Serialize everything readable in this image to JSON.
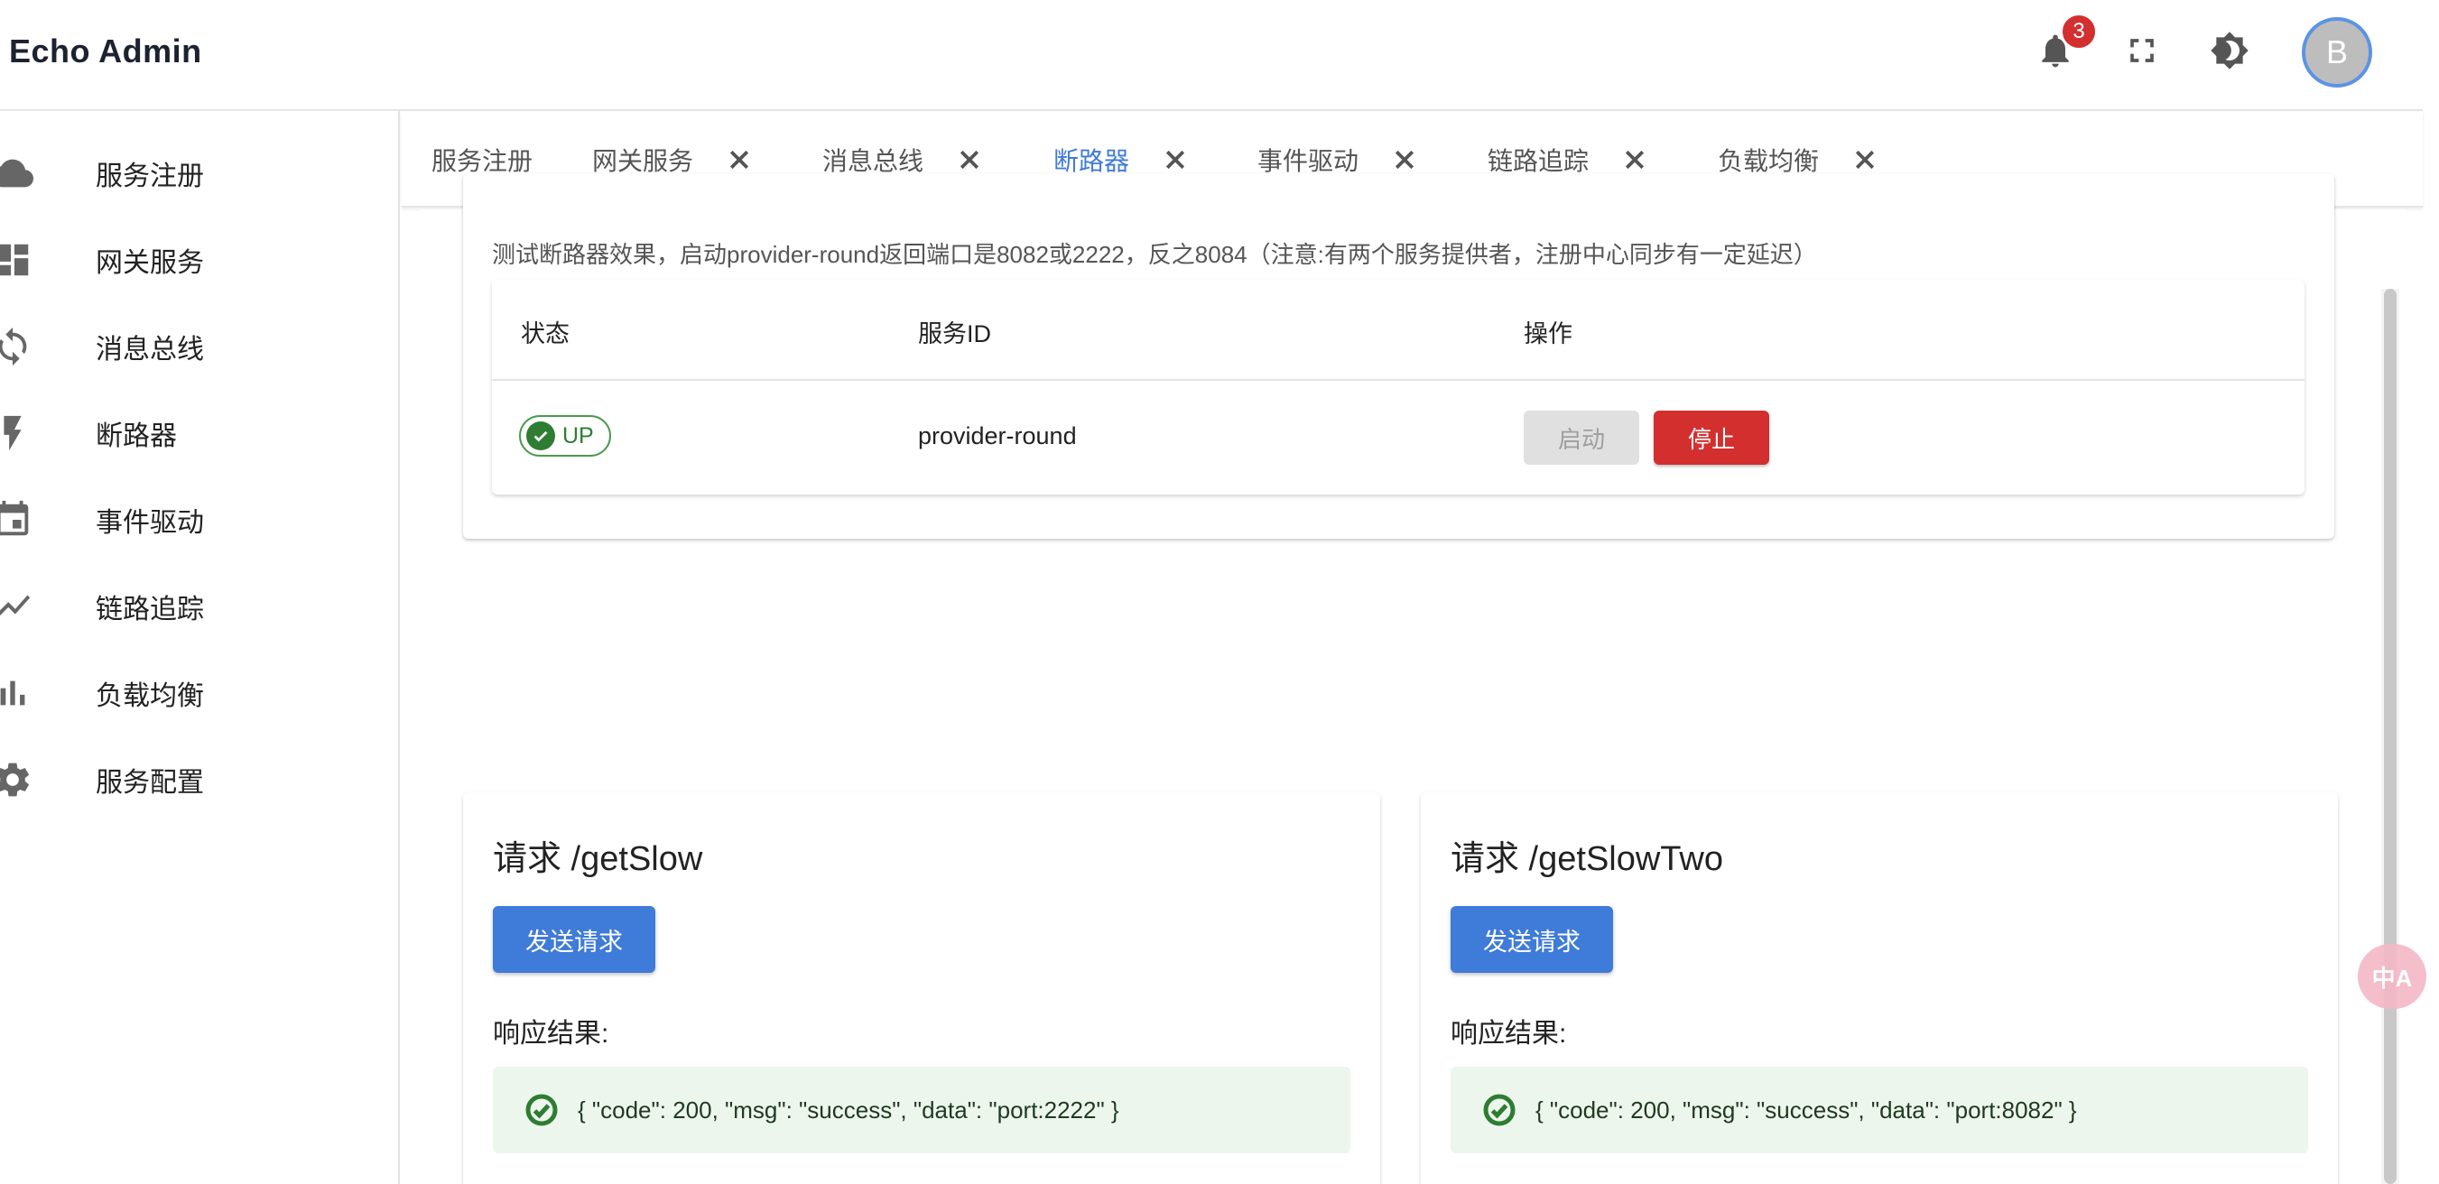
{
  "header": {
    "title": "Echo Admin",
    "notification_count": "3",
    "avatar_letter": "B"
  },
  "sidebar": {
    "items": [
      {
        "label": "服务注册",
        "icon": "cloud-icon"
      },
      {
        "label": "网关服务",
        "icon": "dashboard-icon"
      },
      {
        "label": "消息总线",
        "icon": "sync-icon"
      },
      {
        "label": "断路器",
        "icon": "bolt-icon"
      },
      {
        "label": "事件驱动",
        "icon": "calendar-icon"
      },
      {
        "label": "链路追踪",
        "icon": "trending-icon"
      },
      {
        "label": "负载均衡",
        "icon": "bar-chart-icon"
      },
      {
        "label": "服务配置",
        "icon": "gear-icon"
      }
    ]
  },
  "tabs": [
    {
      "label": "服务注册",
      "closable": false
    },
    {
      "label": "网关服务",
      "closable": true
    },
    {
      "label": "消息总线",
      "closable": true
    },
    {
      "label": "断路器",
      "closable": true,
      "active": true
    },
    {
      "label": "事件驱动",
      "closable": true
    },
    {
      "label": "链路追踪",
      "closable": true
    },
    {
      "label": "负载均衡",
      "closable": true
    }
  ],
  "main": {
    "description": "测试断路器效果，启动provider-round返回端口是8082或2222，反之8084（注意:有两个服务提供者，注册中心同步有一定延迟）",
    "table": {
      "headers": [
        "状态",
        "服务ID",
        "操作"
      ],
      "row": {
        "status": "UP",
        "service_id": "provider-round",
        "start_label": "启动",
        "stop_label": "停止"
      }
    },
    "requests": [
      {
        "title": "请求 /getSlow",
        "send_label": "发送请求",
        "result_label": "响应结果:",
        "result": "{ \"code\": 200, \"msg\": \"success\", \"data\": \"port:2222\" }"
      },
      {
        "title": "请求 /getSlowTwo",
        "send_label": "发送请求",
        "result_label": "响应结果:",
        "result": "{ \"code\": 200, \"msg\": \"success\", \"data\": \"port:8082\" }"
      }
    ]
  },
  "colors": {
    "accent": "#3f7bd8",
    "danger": "#d32f2f",
    "success": "#2e7d32",
    "success_bg": "#edf6ed"
  },
  "floating": {
    "translate_glyph": "中A"
  }
}
